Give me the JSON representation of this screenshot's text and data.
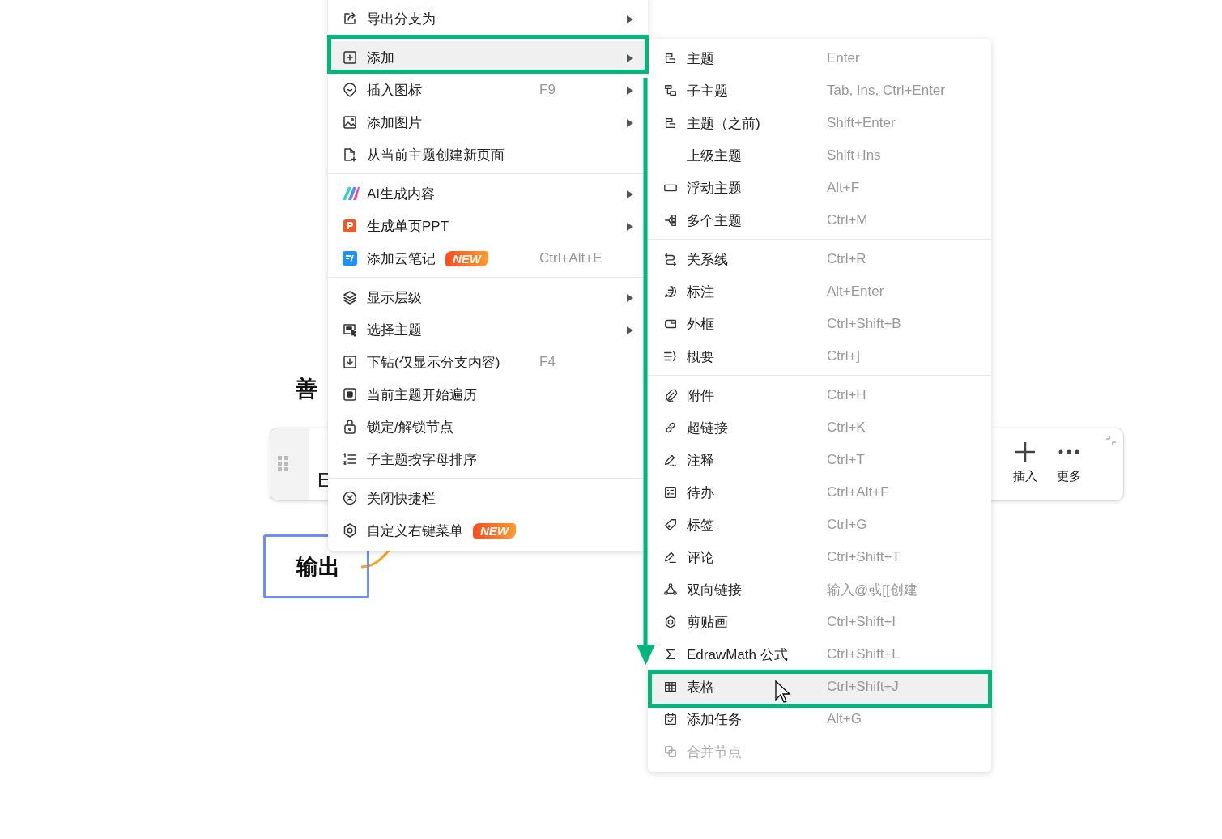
{
  "canvas": {
    "title": "善",
    "toolbar": {
      "text": "E",
      "buttons": [
        {
          "label": "插入"
        },
        {
          "label": "更多"
        }
      ]
    },
    "node": {
      "label": "输出"
    }
  },
  "context_menu": {
    "sections": [
      [
        {
          "label": "导出分支为",
          "submenu": true,
          "selected": false
        }
      ],
      [
        {
          "label": "添加",
          "submenu": true,
          "selected": true
        },
        {
          "label": "插入图标",
          "shortcut": "F9",
          "submenu": true,
          "selected": false
        },
        {
          "label": "添加图片",
          "submenu": true,
          "selected": false
        },
        {
          "label": "从当前主题创建新页面",
          "submenu": false,
          "selected": false
        }
      ],
      [
        {
          "label": "AI生成内容",
          "submenu": true,
          "selected": false
        },
        {
          "label": "生成单页PPT",
          "submenu": true,
          "selected": false
        },
        {
          "label": "添加云笔记",
          "badge": "NEW",
          "shortcut": "Ctrl+Alt+E",
          "submenu": false,
          "selected": false
        }
      ],
      [
        {
          "label": "显示层级",
          "submenu": true,
          "selected": false
        },
        {
          "label": "选择主题",
          "submenu": true,
          "selected": false
        },
        {
          "label": "下钻(仅显示分支内容)",
          "shortcut": "F4",
          "submenu": false,
          "selected": false
        },
        {
          "label": "当前主题开始遍历",
          "submenu": false,
          "selected": false
        },
        {
          "label": "锁定/解锁节点",
          "submenu": false,
          "selected": false
        },
        {
          "label": "子主题按字母排序",
          "submenu": false,
          "selected": false
        }
      ],
      [
        {
          "label": "关闭快捷栏",
          "submenu": false,
          "selected": false
        },
        {
          "label": "自定义右键菜单",
          "badge": "NEW",
          "submenu": false,
          "selected": false
        }
      ]
    ]
  },
  "submenu": {
    "sections": [
      [
        {
          "label": "主题",
          "shortcut": "Enter",
          "selected": false,
          "disabled": false
        },
        {
          "label": "子主题",
          "shortcut": "Tab, Ins, Ctrl+Enter",
          "selected": false,
          "disabled": false
        },
        {
          "label": "主题（之前)",
          "shortcut": "Shift+Enter",
          "selected": false,
          "disabled": false
        },
        {
          "label": "上级主题",
          "shortcut": "Shift+Ins",
          "selected": false,
          "disabled": false
        },
        {
          "label": "浮动主题",
          "shortcut": "Alt+F",
          "selected": false,
          "disabled": false
        },
        {
          "label": "多个主题",
          "shortcut": "Ctrl+M",
          "selected": false,
          "disabled": false
        }
      ],
      [
        {
          "label": "关系线",
          "shortcut": "Ctrl+R",
          "selected": false,
          "disabled": false
        },
        {
          "label": "标注",
          "shortcut": "Alt+Enter",
          "selected": false,
          "disabled": false
        },
        {
          "label": "外框",
          "shortcut": "Ctrl+Shift+B",
          "selected": false,
          "disabled": false
        },
        {
          "label": "概要",
          "shortcut": "Ctrl+]",
          "selected": false,
          "disabled": false
        }
      ],
      [
        {
          "label": "附件",
          "shortcut": "Ctrl+H",
          "selected": false,
          "disabled": false
        },
        {
          "label": "超链接",
          "shortcut": "Ctrl+K",
          "selected": false,
          "disabled": false
        },
        {
          "label": "注释",
          "shortcut": "Ctrl+T",
          "selected": false,
          "disabled": false
        },
        {
          "label": "待办",
          "shortcut": "Ctrl+Alt+F",
          "selected": false,
          "disabled": false
        },
        {
          "label": "标签",
          "shortcut": "Ctrl+G",
          "selected": false,
          "disabled": false
        },
        {
          "label": "评论",
          "shortcut": "Ctrl+Shift+T",
          "selected": false,
          "disabled": false
        },
        {
          "label": "双向链接",
          "shortcut": "输入@或[[创建",
          "selected": false,
          "disabled": false
        },
        {
          "label": "剪贴画",
          "shortcut": "Ctrl+Shift+I",
          "selected": false,
          "disabled": false
        },
        {
          "label": "EdrawMath 公式",
          "shortcut": "Ctrl+Shift+L",
          "selected": false,
          "disabled": false
        },
        {
          "label": "表格",
          "shortcut": "Ctrl+Shift+J",
          "selected": true,
          "disabled": false
        },
        {
          "label": "添加任务",
          "shortcut": "Alt+G",
          "selected": false,
          "disabled": false
        },
        {
          "label": "合并节点",
          "selected": false,
          "disabled": true
        }
      ]
    ]
  }
}
